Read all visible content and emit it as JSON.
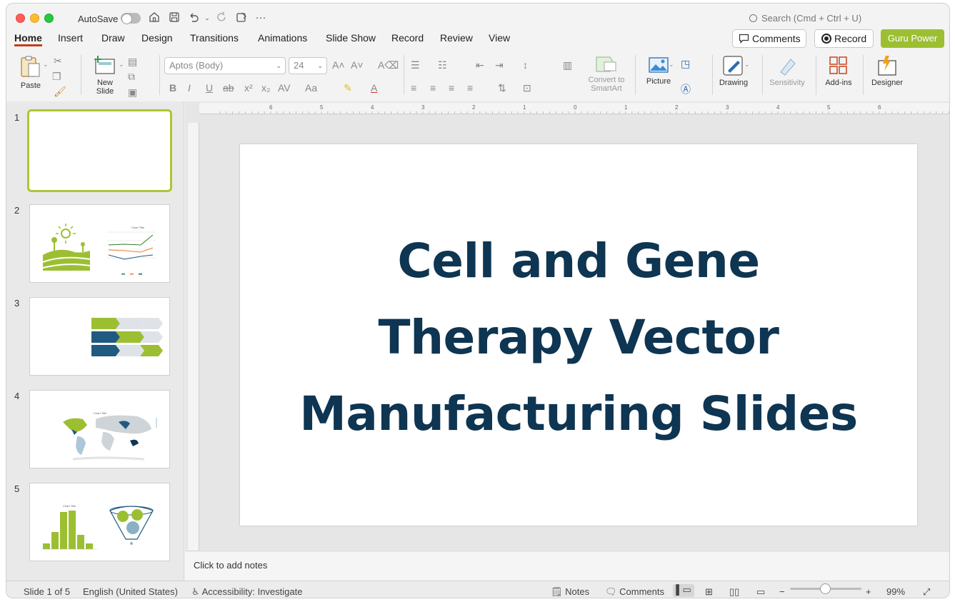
{
  "titlebar": {
    "autosave_label": "AutoSave",
    "autosave_on": false,
    "search_placeholder": "Search (Cmd + Ctrl + U)"
  },
  "tabs": [
    "Home",
    "Insert",
    "Draw",
    "Design",
    "Transitions",
    "Animations",
    "Slide Show",
    "Record",
    "Review",
    "View"
  ],
  "active_tab": "Home",
  "header_buttons": {
    "comments": "Comments",
    "record": "Record",
    "guru": "Guru Power"
  },
  "ribbon": {
    "paste": "Paste",
    "new_slide": "New\nSlide",
    "font_name": "Aptos (Body)",
    "font_size": "24",
    "convert_smartart": "Convert to\nSmartArt",
    "picture": "Picture",
    "drawing": "Drawing",
    "sensitivity": "Sensitivity",
    "addins": "Add-ins",
    "designer": "Designer"
  },
  "slides": [
    {
      "number": "1",
      "selected": true
    },
    {
      "number": "2",
      "thumb_title": "Chart Title"
    },
    {
      "number": "3"
    },
    {
      "number": "4",
      "thumb_title": "Chart Title"
    },
    {
      "number": "5",
      "thumb_title": "Chart Title"
    }
  ],
  "slide": {
    "title_lines": [
      "Cell and Gene",
      "Therapy Vector",
      "Manufacturing Slides"
    ]
  },
  "ruler_labels": [
    "6",
    "5",
    "4",
    "3",
    "2",
    "1",
    "0",
    "1",
    "2",
    "3",
    "4",
    "5",
    "6"
  ],
  "notes_placeholder": "Click to add notes",
  "status": {
    "slide_count": "Slide 1 of 5",
    "language": "English (United States)",
    "accessibility": "Accessibility: Investigate",
    "notes": "Notes",
    "comments": "Comments",
    "zoom": "99%"
  },
  "colors": {
    "title_text": "#0e3552",
    "accent_green": "#9cbf32",
    "accent_blue": "#1f5a80",
    "tab_underline": "#c43e1c"
  }
}
